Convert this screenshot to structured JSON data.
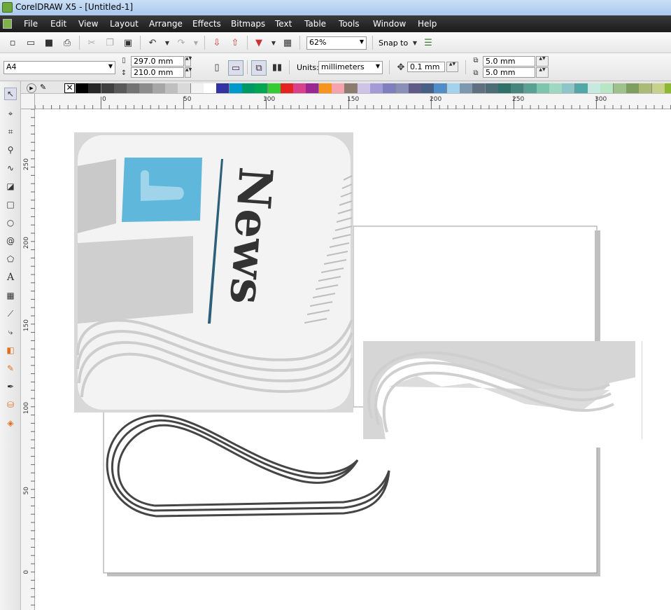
{
  "app": {
    "title": "CorelDRAW X5 - [Untitled-1]"
  },
  "menu": [
    "File",
    "Edit",
    "View",
    "Layout",
    "Arrange",
    "Effects",
    "Bitmaps",
    "Text",
    "Table",
    "Tools",
    "Window",
    "Help"
  ],
  "toolbar": {
    "zoom": "62%",
    "snap_to": "Snap to"
  },
  "property_bar": {
    "page_size": "A4",
    "width": "297.0 mm",
    "height": "210.0 mm",
    "units_label": "Units:",
    "units": "millimeters",
    "nudge": "0.1 mm",
    "dup_x": "5.0 mm",
    "dup_y": "5.0 mm"
  },
  "palette": {
    "colors": [
      "#000000",
      "#262626",
      "#404040",
      "#595959",
      "#737373",
      "#8c8c8c",
      "#a6a6a6",
      "#bfbfbf",
      "#d9d9d9",
      "#f2f2f2",
      "#ffffff",
      "#3333a3",
      "#0099cc",
      "#009966",
      "#00a651",
      "#33cc33",
      "#e52421",
      "#d9418d",
      "#9b2790",
      "#f7941e",
      "#f5a3ac",
      "#8c7b6e",
      "#cfc3e6",
      "#a39bd6",
      "#7e7fbe",
      "#8a8fb8",
      "#5f5b86",
      "#496086",
      "#4f8ec9",
      "#a3d2ef",
      "#7f98ad",
      "#607080",
      "#4c6d76",
      "#2f7069",
      "#45857c",
      "#58a193",
      "#7ec5ae",
      "#9fd7c3",
      "#8dc6c8",
      "#52a8a6",
      "#c7eae0",
      "#b8e5c3",
      "#9ec18e",
      "#7f9e62",
      "#a9bb75",
      "#c6d18a",
      "#8cb832",
      "#aebd3d"
    ]
  },
  "rulers": {
    "h": [
      "0",
      "50",
      "100",
      "150",
      "200",
      "250",
      "300"
    ],
    "v": [
      "250",
      "200",
      "150",
      "100",
      "50",
      "0"
    ]
  }
}
